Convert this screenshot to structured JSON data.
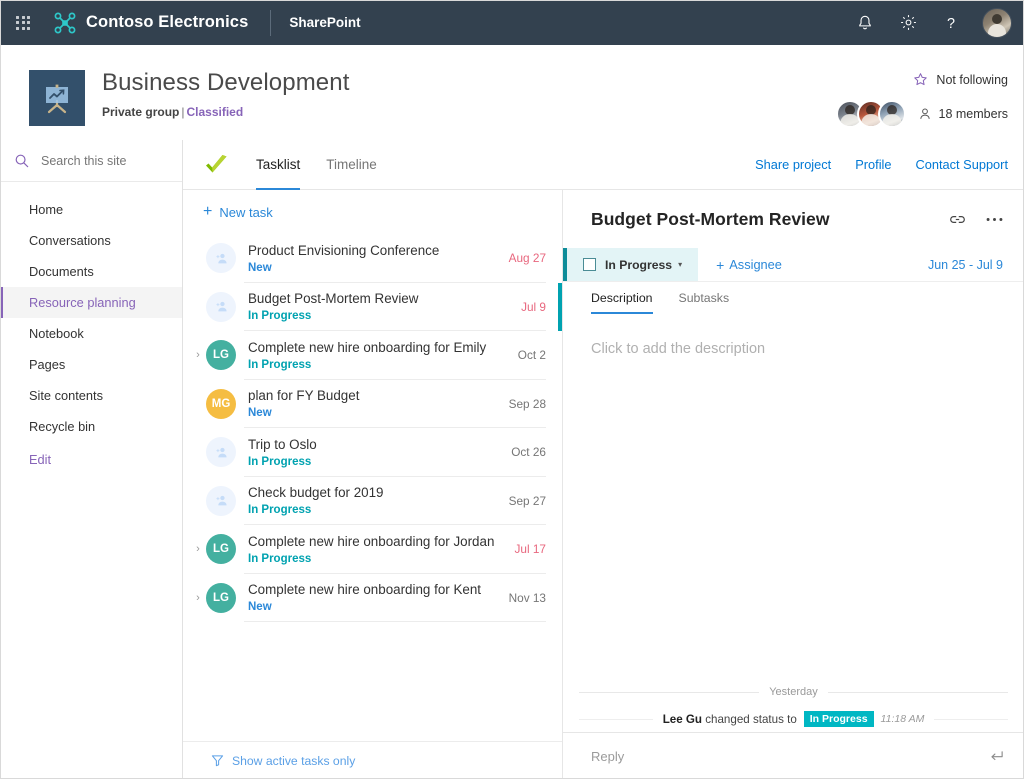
{
  "suitebar": {
    "waffle_label": "app-launcher",
    "brand": "Contoso Electronics",
    "app": "SharePoint",
    "icons": {
      "notification": "bell-icon",
      "settings": "gear-icon",
      "help": "help-icon",
      "avatar": "user-avatar"
    }
  },
  "site": {
    "title": "Business Development",
    "privacy": "Private group",
    "separator": "|",
    "classification": "Classified",
    "follow_label": "Not following",
    "members_label": "18 members"
  },
  "search": {
    "placeholder": "Search this site"
  },
  "sidebar": {
    "items": [
      {
        "label": "Home",
        "selected": false
      },
      {
        "label": "Conversations",
        "selected": false
      },
      {
        "label": "Documents",
        "selected": false
      },
      {
        "label": "Resource planning",
        "selected": true
      },
      {
        "label": "Notebook",
        "selected": false
      },
      {
        "label": "Pages",
        "selected": false
      },
      {
        "label": "Site contents",
        "selected": false
      },
      {
        "label": "Recycle bin",
        "selected": false
      }
    ],
    "edit_label": "Edit"
  },
  "apptoolbar": {
    "tabs": [
      {
        "label": "Tasklist",
        "active": true
      },
      {
        "label": "Timeline",
        "active": false
      }
    ],
    "links": [
      "Share project",
      "Profile",
      "Contact Support"
    ]
  },
  "tasklist": {
    "new_task_label": "New task",
    "new_task_plus": "+",
    "filter_label": "Show active tasks only",
    "tasks": [
      {
        "title": "Product Envisioning Conference",
        "status": "New",
        "status_kind": "new",
        "date": "Aug 27",
        "overdue": true,
        "initials": "",
        "avatar_color": "",
        "expandable": false,
        "selected": false
      },
      {
        "title": "Budget Post-Mortem Review",
        "status": "In Progress",
        "status_kind": "prog",
        "date": "Jul 9",
        "overdue": true,
        "initials": "",
        "avatar_color": "",
        "expandable": false,
        "selected": true
      },
      {
        "title": "Complete new hire onboarding for Emily",
        "status": "In Progress",
        "status_kind": "prog",
        "date": "Oct 2",
        "overdue": false,
        "initials": "LG",
        "avatar_color": "#44b0a0",
        "expandable": true,
        "selected": false
      },
      {
        "title": "plan for FY Budget",
        "status": "New",
        "status_kind": "new",
        "date": "Sep 28",
        "overdue": false,
        "initials": "MG",
        "avatar_color": "#f5bd42",
        "expandable": false,
        "selected": false
      },
      {
        "title": "Trip to Oslo",
        "status": "In Progress",
        "status_kind": "prog",
        "date": "Oct 26",
        "overdue": false,
        "initials": "",
        "avatar_color": "",
        "expandable": false,
        "selected": false
      },
      {
        "title": "Check budget for 2019",
        "status": "In Progress",
        "status_kind": "prog",
        "date": "Sep 27",
        "overdue": false,
        "initials": "",
        "avatar_color": "",
        "expandable": false,
        "selected": false
      },
      {
        "title": "Complete new hire onboarding for Jordan",
        "status": "In Progress",
        "status_kind": "prog",
        "date": "Jul 17",
        "overdue": true,
        "initials": "LG",
        "avatar_color": "#44b0a0",
        "expandable": true,
        "selected": false
      },
      {
        "title": "Complete new hire onboarding for Kent",
        "status": "New",
        "status_kind": "new",
        "date": "Nov 13",
        "overdue": false,
        "initials": "LG",
        "avatar_color": "#44b0a0",
        "expandable": true,
        "selected": false
      }
    ]
  },
  "detail": {
    "title": "Budget Post-Mortem Review",
    "status": "In Progress",
    "status_caret": "▾",
    "assignee_label": "Assignee",
    "assignee_plus": "+",
    "date_range": "Jun 25 - Jul 9",
    "tabs": [
      {
        "label": "Description",
        "active": true
      },
      {
        "label": "Subtasks",
        "active": false
      }
    ],
    "description_placeholder": "Click to add the description",
    "activity": {
      "day_label": "Yesterday",
      "actor": "Lee Gu",
      "action": "changed status to",
      "status_pill": "In Progress",
      "time": "11:18 AM"
    },
    "reply_placeholder": "Reply"
  },
  "colors": {
    "suitebar_bg": "#33414f",
    "accent_purple": "#8764b8",
    "link_blue": "#0078d4",
    "status_new": "#2b88d8",
    "status_progress": "#00a2b0",
    "overdue_red": "#e8677e",
    "teal_pill": "#00b7c3"
  }
}
